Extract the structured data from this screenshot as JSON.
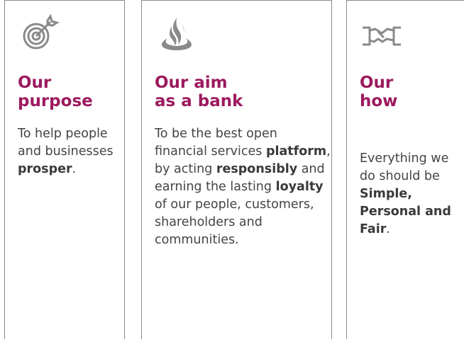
{
  "colors": {
    "heading": "#9c1a5e",
    "text": "#444444",
    "icon": "#8a8a8a",
    "border": "#8a8a8a"
  },
  "cards": [
    {
      "icon": "target-icon",
      "heading_lines": [
        "Our",
        "purpose"
      ],
      "body": [
        {
          "t": "To help people and businesses "
        },
        {
          "t": "prosper",
          "b": true
        },
        {
          "t": "."
        }
      ]
    },
    {
      "icon": "flame-logo-icon",
      "heading_lines": [
        "Our aim",
        "as a bank"
      ],
      "body": [
        {
          "t": "To be the best open financial services "
        },
        {
          "t": "platform",
          "b": true
        },
        {
          "t": ", by acting "
        },
        {
          "t": "responsibly",
          "b": true
        },
        {
          "t": " and earning the lasting "
        },
        {
          "t": "loyalty",
          "b": true
        },
        {
          "t": " of our people, customers, shareholders and communities."
        }
      ]
    },
    {
      "icon": "handshake-icon",
      "heading_lines": [
        "Our",
        "how"
      ],
      "body": [
        {
          "t": "Everything we do should be "
        },
        {
          "t": "Simple, Personal and Fair",
          "b": true
        },
        {
          "t": "."
        }
      ]
    }
  ]
}
